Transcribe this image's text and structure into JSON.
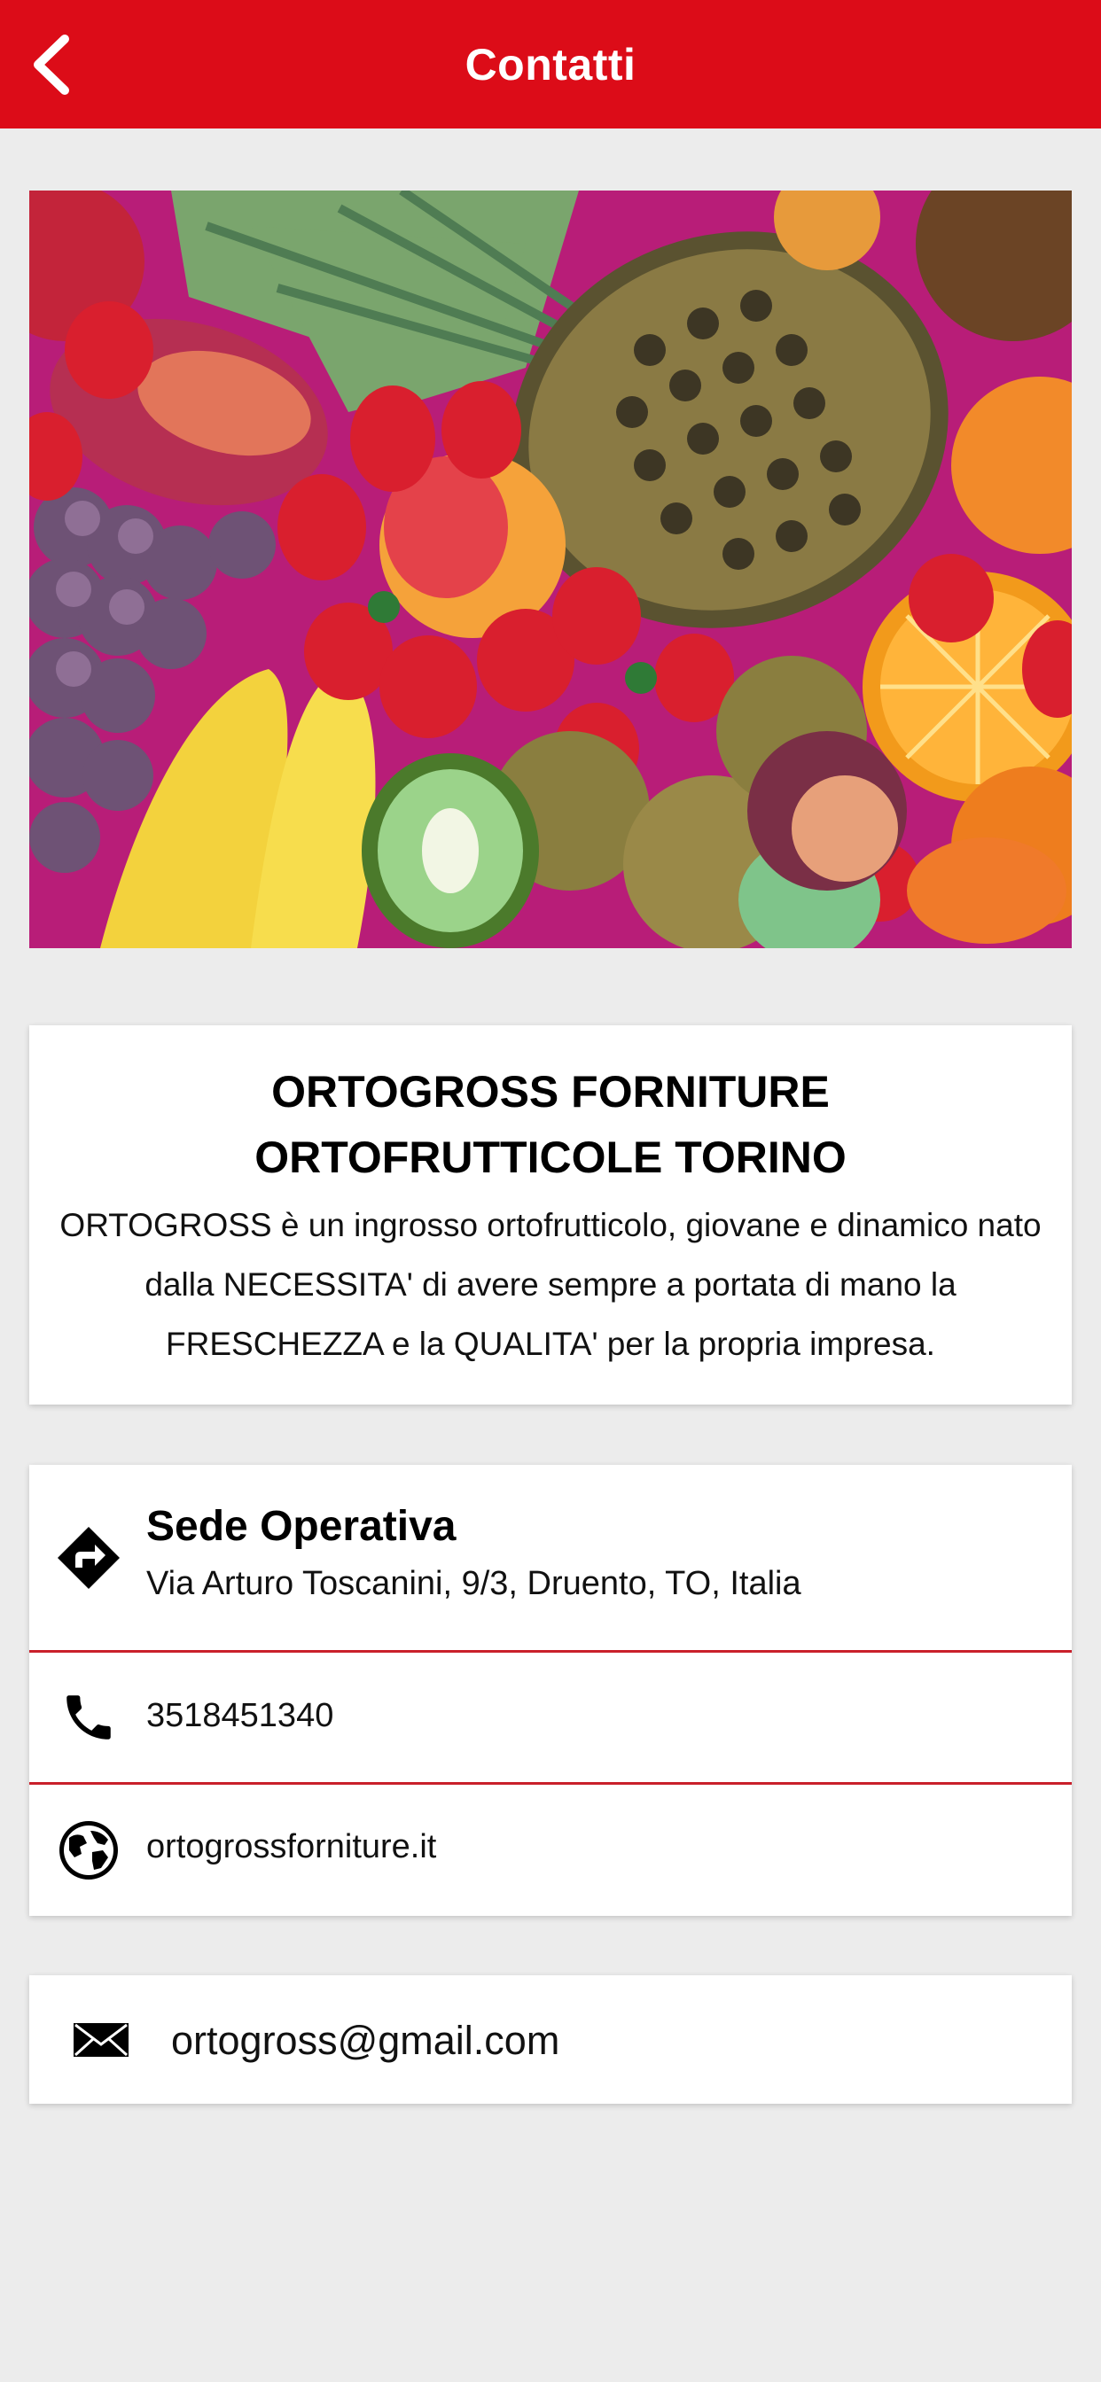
{
  "header": {
    "title": "Contatti",
    "back_icon": "chevron-left-icon",
    "background": "#dc0c18"
  },
  "hero": {
    "image": "fruit-assortment-photo"
  },
  "company": {
    "name": "ORTOGROSS FORNITURE ORTOFRUTTICOLE TORINO",
    "description": "ORTOGROSS è un ingrosso ortofrutticolo, giovane e dinamico nato dalla NECESSITA' di avere sempre a portata di mano la FRESCHEZZA e la QUALITA' per la propria impresa."
  },
  "contacts": {
    "address_title": "Sede Operativa",
    "address": "Via Arturo Toscanini, 9/3, Druento, TO, Italia",
    "address_icon": "directions-icon",
    "phone": "3518451340",
    "phone_icon": "phone-icon",
    "website": "ortogrossforniture.it",
    "website_icon": "globe-icon",
    "divider_color": "#c9202b"
  },
  "email": {
    "address": "ortogross@gmail.com",
    "icon": "mail-icon"
  }
}
